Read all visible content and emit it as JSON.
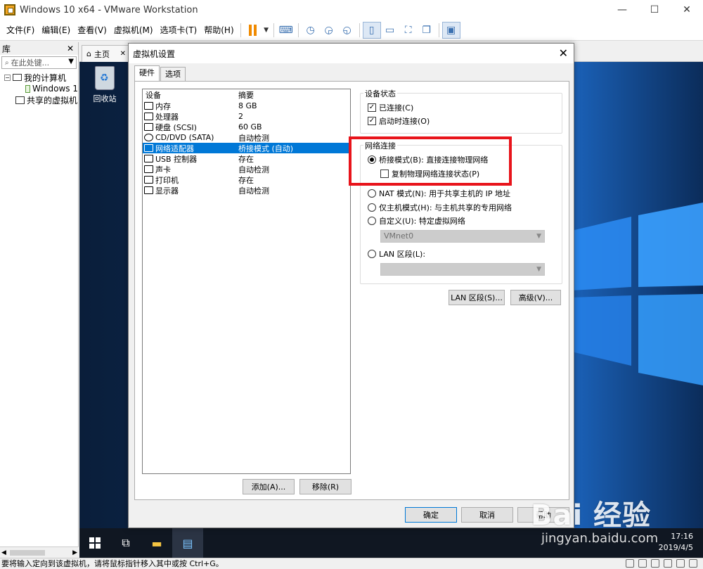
{
  "window": {
    "title": "Windows 10 x64 - VMware Workstation"
  },
  "menu": [
    "文件(F)",
    "编辑(E)",
    "查看(V)",
    "虚拟机(M)",
    "选项卡(T)",
    "帮助(H)"
  ],
  "library": {
    "title": "库",
    "search_placeholder": "在此处键...",
    "tree": [
      "我的计算机",
      "Windows 1",
      "共享的虚拟机"
    ]
  },
  "vm_tab": {
    "label": "主页"
  },
  "desktop": {
    "recycle_bin": "回收站"
  },
  "taskbar": {
    "time": "17:16",
    "date": "2019/4/5"
  },
  "statusbar": {
    "text": "要将输入定向到该虚拟机，请将鼠标指针移入其中或按 Ctrl+G。"
  },
  "dialog": {
    "title": "虚拟机设置",
    "tabs": [
      "硬件",
      "选项"
    ],
    "device_header": {
      "device": "设备",
      "summary": "摘要"
    },
    "devices": [
      {
        "name": "内存",
        "summary": "8 GB"
      },
      {
        "name": "处理器",
        "summary": "2"
      },
      {
        "name": "硬盘 (SCSI)",
        "summary": "60 GB"
      },
      {
        "name": "CD/DVD (SATA)",
        "summary": "自动检测"
      },
      {
        "name": "网络适配器",
        "summary": "桥接模式 (自动)"
      },
      {
        "name": "USB 控制器",
        "summary": "存在"
      },
      {
        "name": "声卡",
        "summary": "自动检测"
      },
      {
        "name": "打印机",
        "summary": "存在"
      },
      {
        "name": "显示器",
        "summary": "自动检测"
      }
    ],
    "add_button": "添加(A)...",
    "remove_button": "移除(R)",
    "device_status": {
      "title": "设备状态",
      "connected": "已连接(C)",
      "connect_on_start": "启动时连接(O)"
    },
    "network": {
      "title": "网络连接",
      "bridged": "桥接模式(B): 直接连接物理网络",
      "replicate": "复制物理网络连接状态(P)",
      "nat": "NAT 模式(N): 用于共享主机的 IP 地址",
      "host_only": "仅主机模式(H): 与主机共享的专用网络",
      "custom": "自定义(U): 特定虚拟网络",
      "vmnet": "VMnet0",
      "lan_segment": "LAN 区段(L):"
    },
    "lan_segments_button": "LAN 区段(S)...",
    "advanced_button": "高级(V)...",
    "ok_button": "确定",
    "cancel_button": "取消",
    "help_button": "帮助"
  },
  "watermark": {
    "brand": "Bai 经验",
    "url": "jingyan.baidu.com"
  },
  "colors": {
    "selection": "#0078d7",
    "highlight": "#e8141b",
    "accent": "#f08a00"
  }
}
